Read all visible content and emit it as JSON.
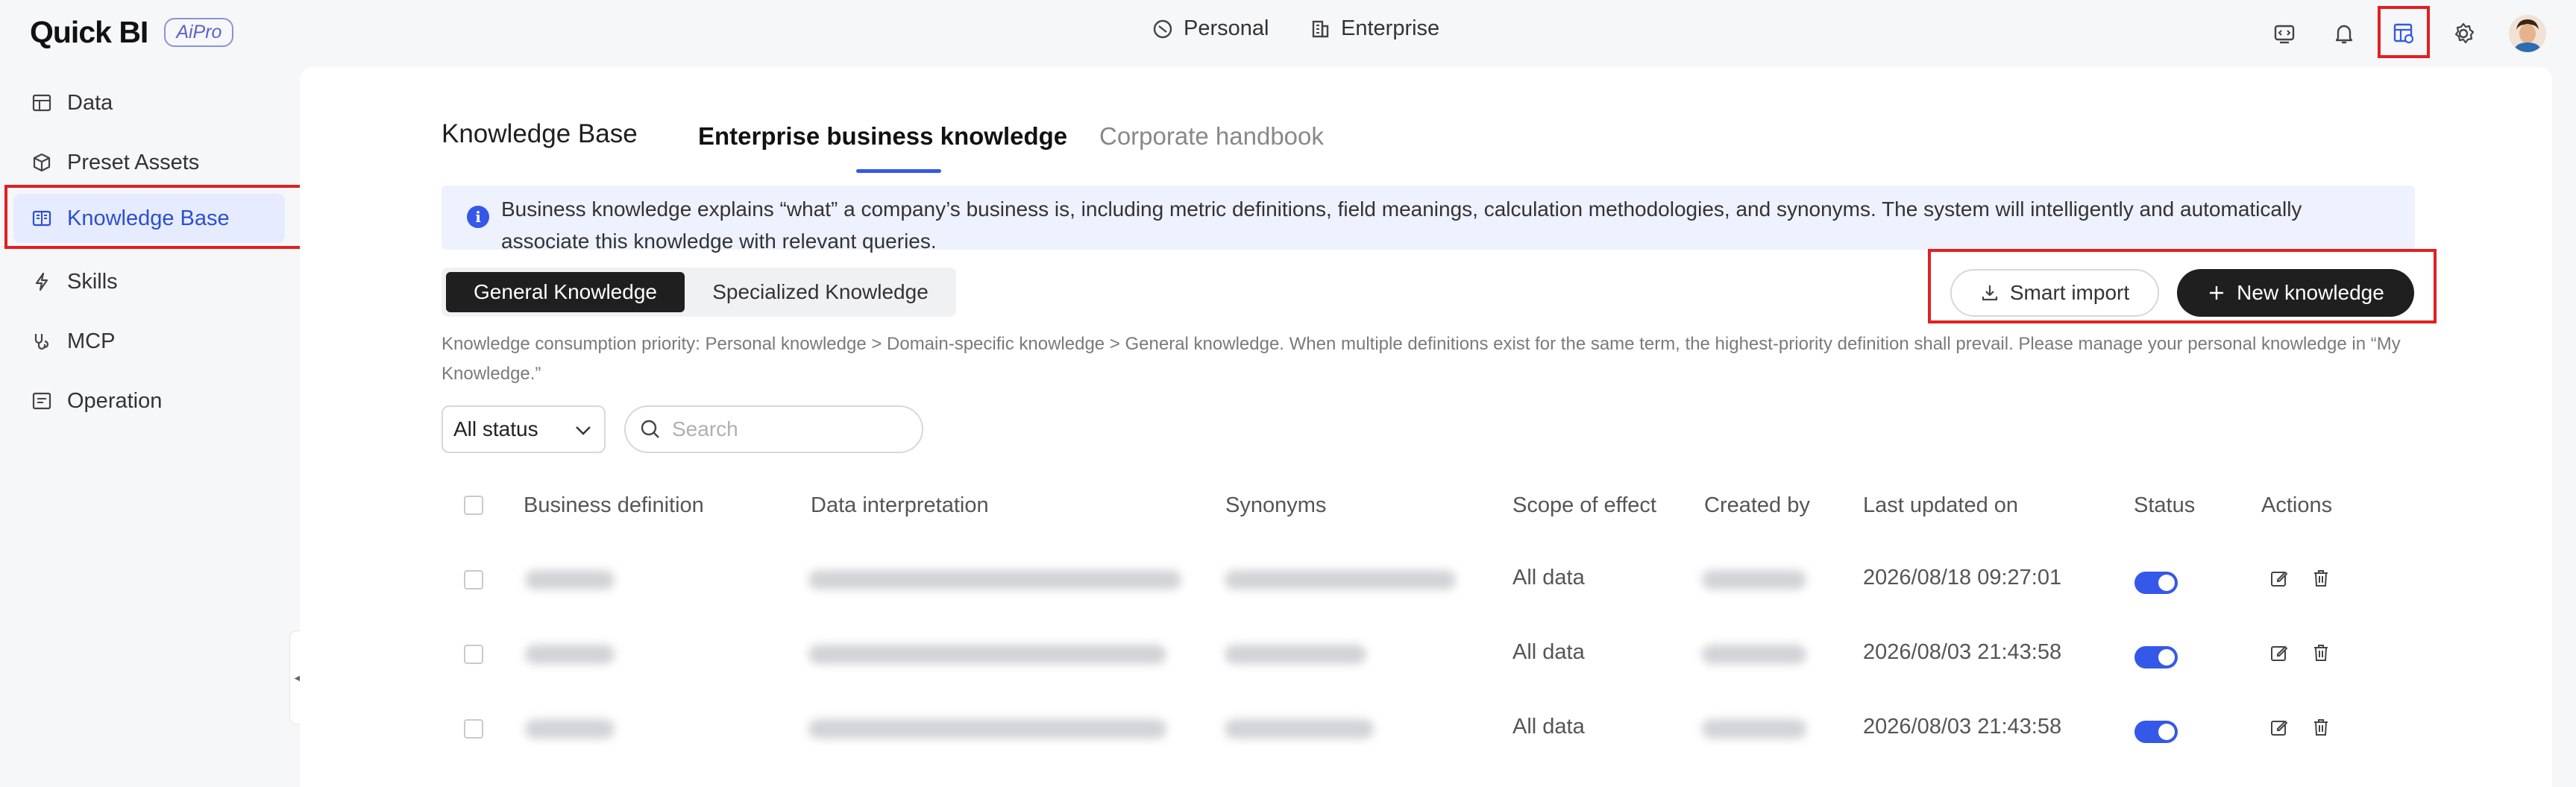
{
  "app": {
    "logo_text": "Quick BI",
    "logo_badge": "AiPro"
  },
  "topnav": {
    "personal_label": "Personal",
    "enterprise_label": "Enterprise"
  },
  "sidebar": {
    "items": [
      {
        "label": "Data",
        "icon": "data-icon"
      },
      {
        "label": "Preset Assets",
        "icon": "cube-icon"
      },
      {
        "label": "Knowledge Base",
        "icon": "book-icon",
        "active": true
      },
      {
        "label": "Skills",
        "icon": "bolt-icon"
      },
      {
        "label": "MCP",
        "icon": "mcp-icon"
      },
      {
        "label": "Operation",
        "icon": "operation-icon"
      }
    ]
  },
  "main": {
    "title": "Knowledge Base",
    "tabs": [
      {
        "label": "Enterprise business knowledge",
        "active": true
      },
      {
        "label": "Corporate handbook",
        "active": false
      }
    ],
    "banner_text": "Business knowledge explains “what” a company’s business is, including metric definitions, field meanings, calculation methodologies, and synonyms. The system will intelligently and automatically associate this knowledge with relevant queries.",
    "segments": [
      {
        "label": "General Knowledge",
        "selected": true
      },
      {
        "label": "Specialized Knowledge",
        "selected": false
      }
    ],
    "smart_import_label": "Smart import",
    "new_knowledge_label": "New knowledge",
    "priority_text": "Knowledge consumption priority: Personal knowledge > Domain-specific knowledge > General knowledge. When multiple definitions exist for the same term, the highest-priority definition shall prevail. Please manage your personal knowledge in “My Knowledge.”",
    "status_filter_value": "All status",
    "search_placeholder": "Search"
  },
  "table": {
    "headers": {
      "business_definition": "Business definition",
      "data_interpretation": "Data interpretation",
      "synonyms": "Synonyms",
      "scope": "Scope of effect",
      "created_by": "Created by",
      "last_updated": "Last updated on",
      "status": "Status",
      "actions": "Actions"
    },
    "rows": [
      {
        "scope": "All data",
        "last_updated": "2026/08/18 09:27:01",
        "status_enabled": true
      },
      {
        "scope": "All data",
        "last_updated": "2026/08/03 21:43:58",
        "status_enabled": true
      },
      {
        "scope": "All data",
        "last_updated": "2026/08/03 21:43:58",
        "status_enabled": true
      }
    ]
  },
  "colors": {
    "accent": "#3458e8",
    "highlight": "#e02020",
    "active_bg": "#e6ebff"
  }
}
